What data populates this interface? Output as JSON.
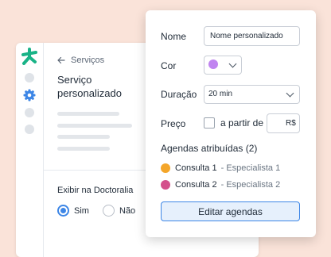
{
  "background_window": {
    "back_label": "Serviços",
    "title": "Serviço personalizado",
    "exhibit_label": "Exibir na Doctoralia",
    "options": [
      {
        "label": "Sim",
        "selected": true
      },
      {
        "label": "Não",
        "selected": false
      }
    ],
    "nav_icons": [
      "doctoralia-logo-icon",
      "nav-dot-icon",
      "gear-icon",
      "nav-dot-icon",
      "nav-dot-icon"
    ]
  },
  "modal": {
    "name_label": "Nome",
    "name_value": "Nome personalizado",
    "color_label": "Cor",
    "color_value": "#c084f0",
    "duration_label": "Duração",
    "duration_value": "20 min",
    "price_label": "Preço",
    "price_checkbox_label": "a partir de",
    "price_checked": false,
    "currency": "R$",
    "agendas_title": "Agendas atribuídas (2)",
    "agendas": [
      {
        "name": "Consulta 1",
        "specialist": "- Especialista 1",
        "color": "#f4a62a"
      },
      {
        "name": "Consulta 2",
        "specialist": "- Especialista 2",
        "color": "#d4508c"
      }
    ],
    "edit_button": "Editar agendas"
  },
  "colors": {
    "accent": "#3d86e6",
    "brand_green": "#19b387",
    "page_background": "#fae3d9"
  }
}
